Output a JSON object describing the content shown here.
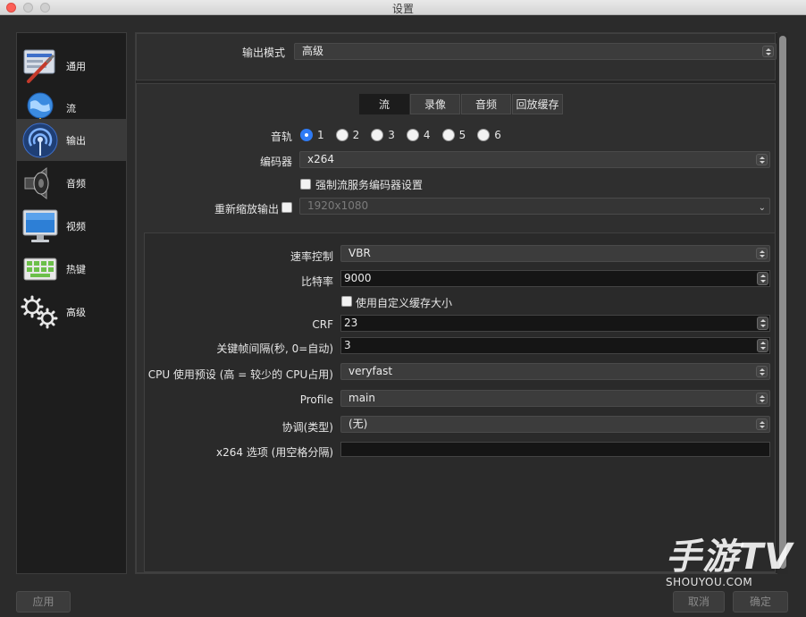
{
  "window": {
    "title": "设置"
  },
  "sidebar": {
    "items": [
      {
        "label": "通用",
        "icon": "general-settings-icon"
      },
      {
        "label": "流",
        "icon": "globe-network-icon"
      },
      {
        "label": "输出",
        "icon": "broadcast-antenna-icon",
        "active": true
      },
      {
        "label": "音频",
        "icon": "speaker-icon"
      },
      {
        "label": "视频",
        "icon": "monitor-icon"
      },
      {
        "label": "热键",
        "icon": "keyboard-icon"
      },
      {
        "label": "高级",
        "icon": "gears-icon"
      }
    ]
  },
  "output_mode": {
    "label": "输出模式",
    "value": "高级"
  },
  "tabs": [
    {
      "label": "流",
      "active": true
    },
    {
      "label": "录像"
    },
    {
      "label": "音频"
    },
    {
      "label": "回放缓存"
    }
  ],
  "stream": {
    "audio_track": {
      "label": "音轨",
      "options": [
        "1",
        "2",
        "3",
        "4",
        "5",
        "6"
      ],
      "selected": "1"
    },
    "encoder": {
      "label": "编码器",
      "value": "x264"
    },
    "enforce_service": {
      "label": "强制流服务编码器设置",
      "checked": false
    },
    "rescale": {
      "label": "重新缩放输出",
      "checked": false,
      "value": "1920x1080"
    }
  },
  "encoder_settings": {
    "rate_control": {
      "label": "速率控制",
      "value": "VBR"
    },
    "bitrate": {
      "label": "比特率",
      "value": "9000"
    },
    "custom_buffer": {
      "label": "使用自定义缓存大小",
      "checked": false
    },
    "crf": {
      "label": "CRF",
      "value": "23"
    },
    "keyframe_interval": {
      "label": "关键帧间隔(秒, 0=自动)",
      "value": "3"
    },
    "cpu_preset": {
      "label": "CPU 使用预设 (高 = 较少的 CPU占用)",
      "value": "veryfast"
    },
    "profile": {
      "label": "Profile",
      "value": "main"
    },
    "tune": {
      "label": "协调(类型)",
      "value": "(无)"
    },
    "x264_options": {
      "label": "x264 选项 (用空格分隔)",
      "value": ""
    }
  },
  "footer": {
    "apply": "应用",
    "cancel": "取消",
    "ok": "确定"
  },
  "watermark": {
    "logo": "手游TV",
    "site": "SHOUYOU.COM"
  },
  "colors": {
    "accent": "#2f7bf5",
    "close_button": "#fc5f57",
    "background": "#2b2b2b"
  }
}
